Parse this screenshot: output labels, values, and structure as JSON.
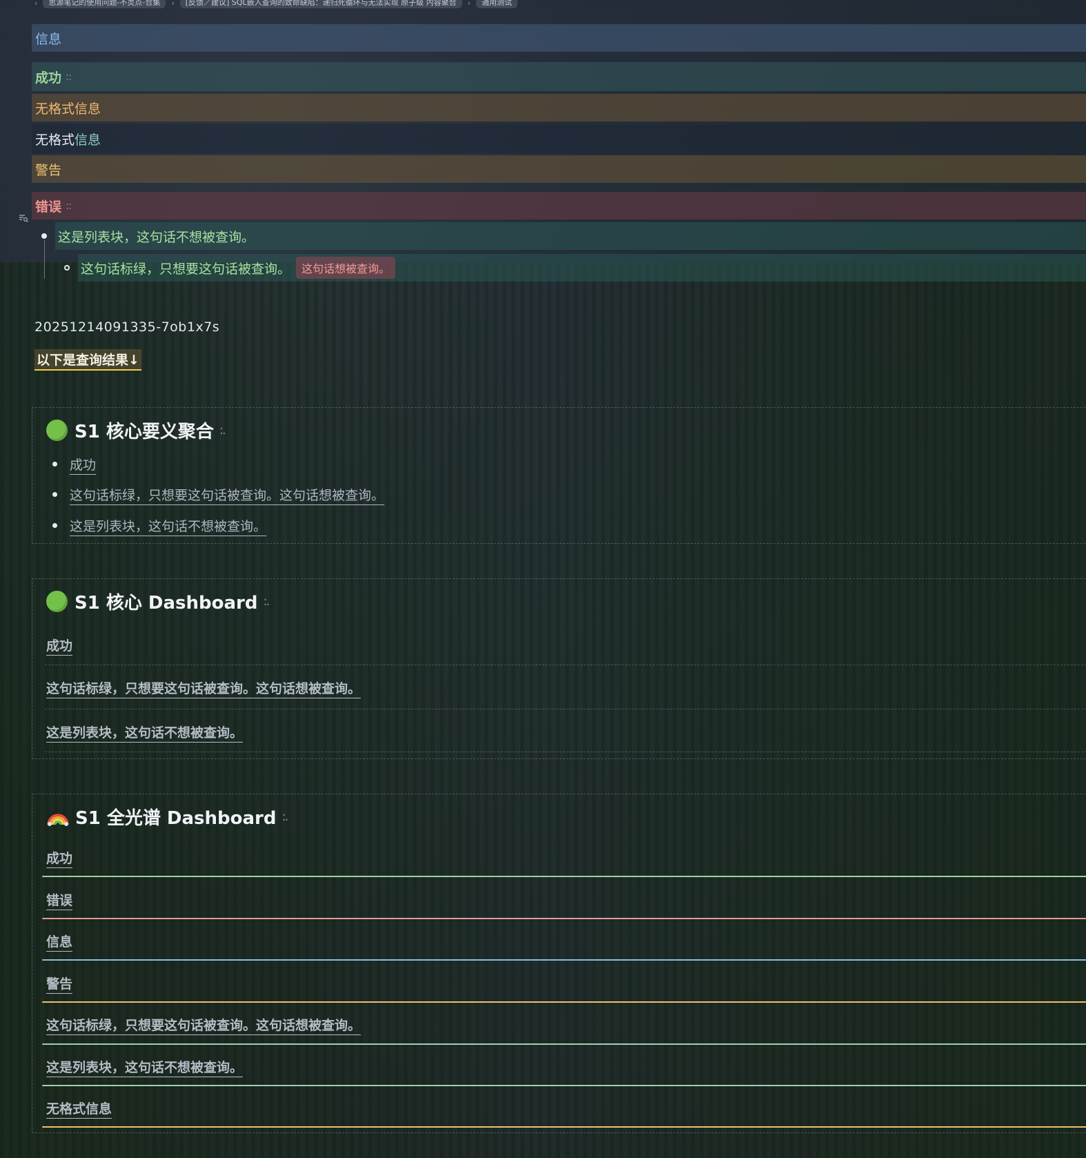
{
  "breadcrumb": {
    "items": [
      "思源笔记的使用问题-不灵点-合集",
      "[反馈／建议] SQL嵌入查询的致命缺陷：递归死循环与无法实现 原子级 内容聚合",
      "通用测试"
    ]
  },
  "blocks": {
    "info": "信息",
    "success": "成功",
    "plain_orange": "无格式信息",
    "plain_prefix": "无格式",
    "plain_highlight": "信息",
    "warning": "警告",
    "error": "错误",
    "drag_glyph": "::"
  },
  "list": {
    "item1": "这是列表块，这句话不想被查询。",
    "item2": "这句话标绿，只想要这句话被查询。",
    "item2_tag": "这句话想被查询。"
  },
  "doc_id": "20251214091335-7ob1x7s",
  "query_label": "以下是查询结果↓",
  "panel1": {
    "title": "S1 核心要义聚合",
    "items": [
      "成功",
      "这句话标绿，只想要这句话被查询。这句话想被查询。",
      "这是列表块，这句话不想被查询。"
    ]
  },
  "panel2": {
    "title": "S1 核心 Dashboard",
    "items": [
      "成功",
      "这句话标绿，只想要这句话被查询。这句话想被查询。",
      "这是列表块，这句话不想被查询。"
    ]
  },
  "panel3": {
    "title": "S1 全光谱 Dashboard",
    "items": [
      {
        "label": "成功",
        "color": "#9ed39a"
      },
      {
        "label": "错误",
        "color": "#e89a94"
      },
      {
        "label": "信息",
        "color": "#8fbbe8"
      },
      {
        "label": "警告",
        "color": "#f0c070"
      },
      {
        "label": "这句话标绿，只想要这句话被查询。这句话想被查询。",
        "color": "#9ed3b0"
      },
      {
        "label": "这是列表块，这句话不想被查询。",
        "color": "#9ed3b0"
      },
      {
        "label": "无格式信息",
        "color": "#f0c070"
      }
    ]
  },
  "icons": {
    "gutter": "list-search-icon",
    "panel1": "green-circle-icon",
    "panel2": "green-circle-icon",
    "panel3": "rainbow-icon"
  }
}
